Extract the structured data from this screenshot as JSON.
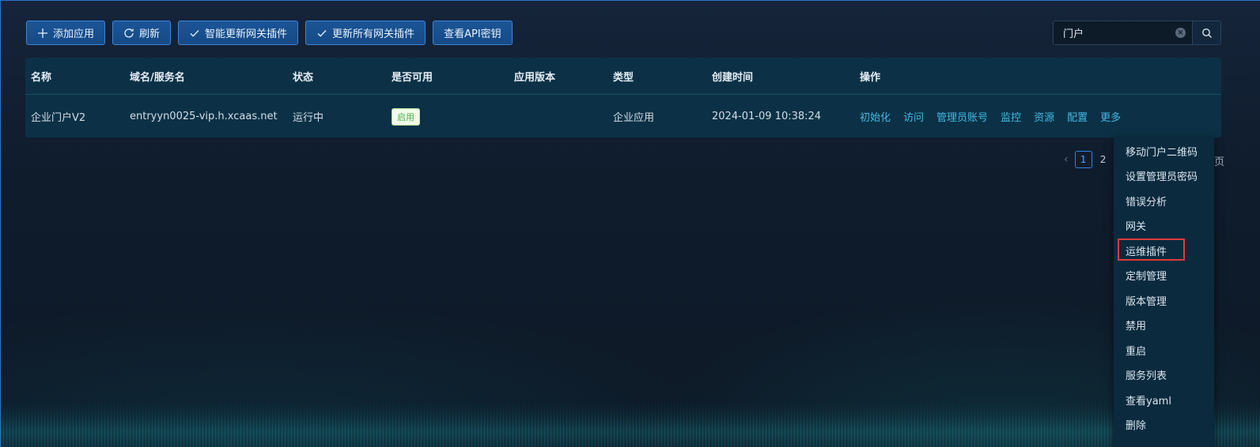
{
  "toolbar": {
    "add_label": "添加应用",
    "refresh_label": "刷新",
    "smart_update_label": "智能更新网关插件",
    "update_all_label": "更新所有网关插件",
    "api_key_label": "查看API密钥"
  },
  "search": {
    "value": "门户"
  },
  "table": {
    "headers": [
      "名称",
      "域名/服务名",
      "状态",
      "是否可用",
      "应用版本",
      "类型",
      "创建时间",
      "操作"
    ],
    "rows": [
      {
        "name": "企业门户V2",
        "domain": "entryyn0025-vip.h.xcaas.net",
        "status": "运行中",
        "available": "启用",
        "version": "",
        "type": "企业应用",
        "created": "2024-01-09 10:38:24",
        "actions": [
          "初始化",
          "访问",
          "管理员账号",
          "监控",
          "资源",
          "配置",
          "更多"
        ]
      }
    ]
  },
  "pagination": {
    "current": "1",
    "next": "2",
    "tail": "页"
  },
  "more_menu": {
    "items": [
      "移动门户二维码",
      "设置管理员密码",
      "错误分析",
      "网关",
      "运维插件",
      "定制管理",
      "版本管理",
      "禁用",
      "重启",
      "服务列表",
      "查看yaml",
      "删除"
    ],
    "highlighted": "运维插件"
  },
  "colors": {
    "button_bg": "#1b5597",
    "link": "#41b8e4",
    "badge_green": "#46b04a",
    "highlight_red": "#e0393a",
    "table_bg": "#0c3146"
  }
}
